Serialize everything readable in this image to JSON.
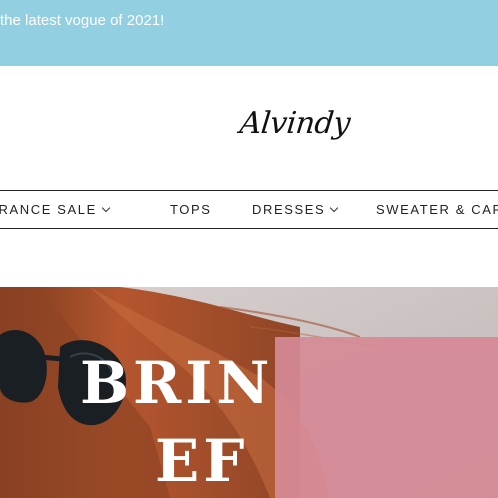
{
  "announcement": {
    "text": "the latest vogue of 2021!"
  },
  "brand": {
    "logo_text": "Alvindy"
  },
  "nav": {
    "items": [
      {
        "label": "EARANCE SALE",
        "has_dropdown": true
      },
      {
        "label": "TOPS",
        "has_dropdown": false
      },
      {
        "label": "DRESSES",
        "has_dropdown": true
      },
      {
        "label": "SWEATER & CAR",
        "has_dropdown": false
      }
    ]
  },
  "hero": {
    "headline_line1": "BRIN",
    "headline_line2": "EF"
  },
  "colors": {
    "announcement_bg": "#92cfe0",
    "promo_box": "#d68a96",
    "hair": "#b5562f",
    "sunglasses": "#1a1f24"
  }
}
